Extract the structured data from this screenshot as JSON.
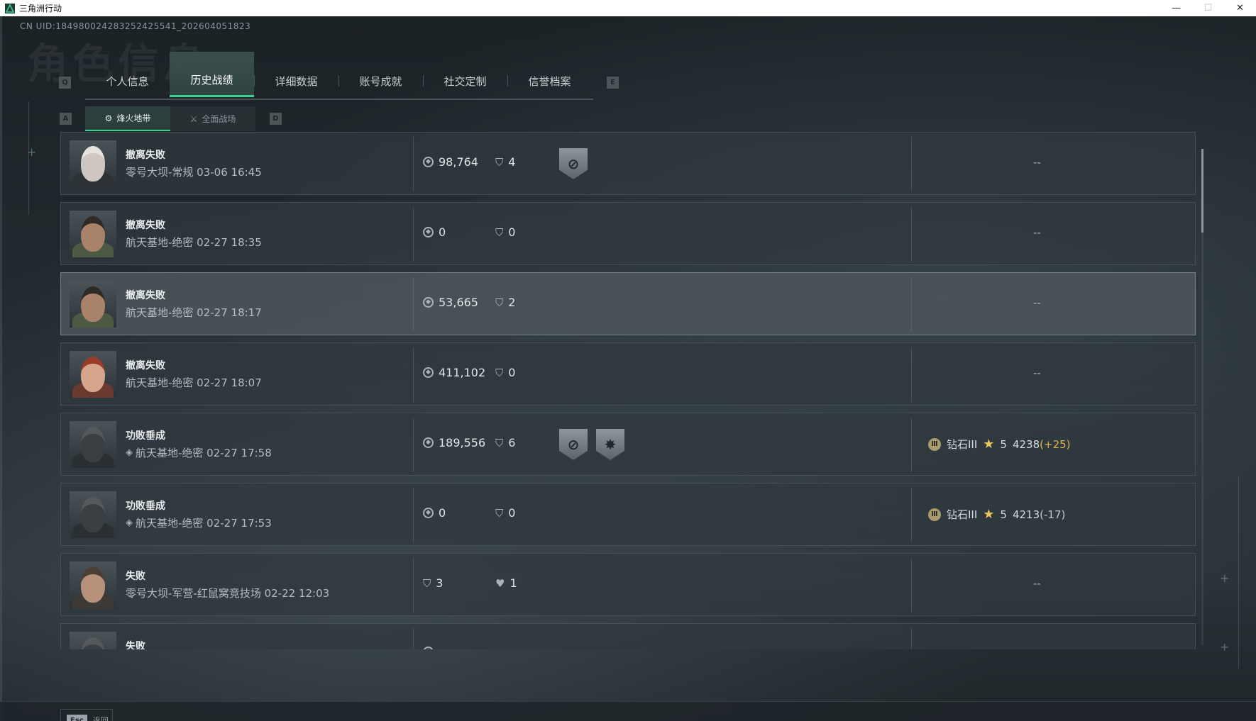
{
  "window": {
    "title": "三角洲行动",
    "minimize": "—",
    "maximize": "☐",
    "close": "✕"
  },
  "uid": "CN UID:18498002428325242554​1_202604051823",
  "watermark": "角色信息",
  "keys": {
    "prev_tab": "Q",
    "next_tab": "E",
    "prev_sub": "A",
    "next_sub": "D"
  },
  "tabs": [
    {
      "label": "个人信息",
      "active": false
    },
    {
      "label": "历史战绩",
      "active": true
    },
    {
      "label": "详细数据",
      "active": false
    },
    {
      "label": "账号成就",
      "active": false
    },
    {
      "label": "社交定制",
      "active": false
    },
    {
      "label": "信誉档案",
      "active": false
    }
  ],
  "subtabs": [
    {
      "label": "烽火地带",
      "icon": "fire-zone-icon",
      "active": true
    },
    {
      "label": "全面战场",
      "icon": "battlefield-icon",
      "active": false
    }
  ],
  "records": [
    {
      "outcome": "撤离失败",
      "map": "零号大坝-常规 03-06 16:45",
      "stat1": "98,764",
      "stat2": "4",
      "stat1_icon": "coin-icon",
      "stat2_icon": "shield-icon",
      "badges": [
        "no-extract-badge"
      ],
      "result": "--",
      "avatar": "female-mask"
    },
    {
      "outcome": "撤离失败",
      "map": "航天基地-绝密 02-27 18:35",
      "stat1": "0",
      "stat2": "0",
      "stat1_icon": "coin-icon",
      "stat2_icon": "shield-icon",
      "badges": [],
      "result": "--",
      "avatar": "bearded-goggles"
    },
    {
      "outcome": "撤离失败",
      "map": "航天基地-绝密 02-27 18:17",
      "stat1": "53,665",
      "stat2": "2",
      "stat1_icon": "coin-icon",
      "stat2_icon": "shield-icon",
      "badges": [],
      "result": "--",
      "avatar": "bearded-goggles",
      "highlight": true
    },
    {
      "outcome": "撤离失败",
      "map": "航天基地-绝密 02-27 18:07",
      "stat1": "411,102",
      "stat2": "0",
      "stat1_icon": "coin-icon",
      "stat2_icon": "shield-icon",
      "badges": [],
      "result": "--",
      "avatar": "red-hair"
    },
    {
      "outcome": "功败垂成",
      "map": "航天基地-绝密 02-27 17:58",
      "stat1": "189,556",
      "stat2": "6",
      "stat1_icon": "coin-icon",
      "stat2_icon": "shield-icon",
      "badges": [
        "no-extract-badge",
        "kill-badge"
      ],
      "rank": {
        "tier": "钻石III",
        "stars": "5",
        "score": "4238",
        "delta": "(+25)",
        "delta_positive": true
      },
      "avatar": "helmet",
      "has_mode_icon": true
    },
    {
      "outcome": "功败垂成",
      "map": "航天基地-绝密 02-27 17:53",
      "stat1": "0",
      "stat2": "0",
      "stat1_icon": "coin-icon",
      "stat2_icon": "shield-icon",
      "badges": [],
      "rank": {
        "tier": "钻石III",
        "stars": "5",
        "score": "4213",
        "delta": "(-17)",
        "delta_positive": false
      },
      "avatar": "helmet",
      "has_mode_icon": true
    },
    {
      "outcome": "失败",
      "map": "零号大坝-军营-红鼠窝竞技场 02-22 12:03",
      "stat1": "3",
      "stat2": "1",
      "stat1_icon": "shield-icon",
      "stat2_icon": "handshake-icon",
      "badges": [],
      "result": "--",
      "avatar": "long-hair"
    },
    {
      "outcome": "失败",
      "map": "",
      "stat1": "",
      "stat2": "",
      "stat1_icon": "coin-icon",
      "stat2_icon": "",
      "badges": [],
      "result": "",
      "avatar": "helmet"
    }
  ],
  "bottom": {
    "esc_key": "Esc",
    "esc_label": "返回"
  },
  "colors": {
    "accent": "#3fcf93",
    "gold": "#d9b44a",
    "panel": "#30383d"
  }
}
